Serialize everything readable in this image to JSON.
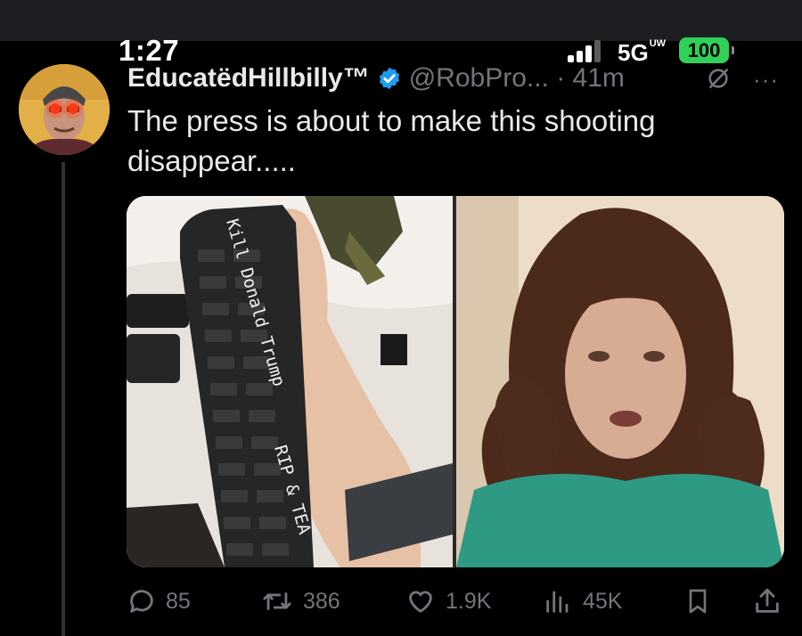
{
  "status_bar": {
    "time": "1:27",
    "network": "5G",
    "network_sup": "UW",
    "battery": "100"
  },
  "tweet": {
    "author_name": "EducatëdHillbilly™",
    "handle_time": "@RobPro... · 41m",
    "more": "···",
    "text": "The press is about to make this shooting disappear.....",
    "media_left_text": {
      "line1": "Kill Donald Trump",
      "line2": "RIP & TEA"
    },
    "actions": {
      "replies": "85",
      "retweets": "386",
      "likes": "1.9K",
      "views": "45K"
    }
  },
  "colors": {
    "background": "#000000",
    "text": "#e7e9ea",
    "muted": "#71767b",
    "verified": "#1d9bf0",
    "battery": "#30d158"
  },
  "icons": {
    "verified": "verified-badge-icon",
    "grok": "grok-icon",
    "reply": "reply-icon",
    "retweet": "retweet-icon",
    "like": "heart-icon",
    "views": "views-icon",
    "bookmark": "bookmark-icon",
    "share": "share-icon"
  }
}
